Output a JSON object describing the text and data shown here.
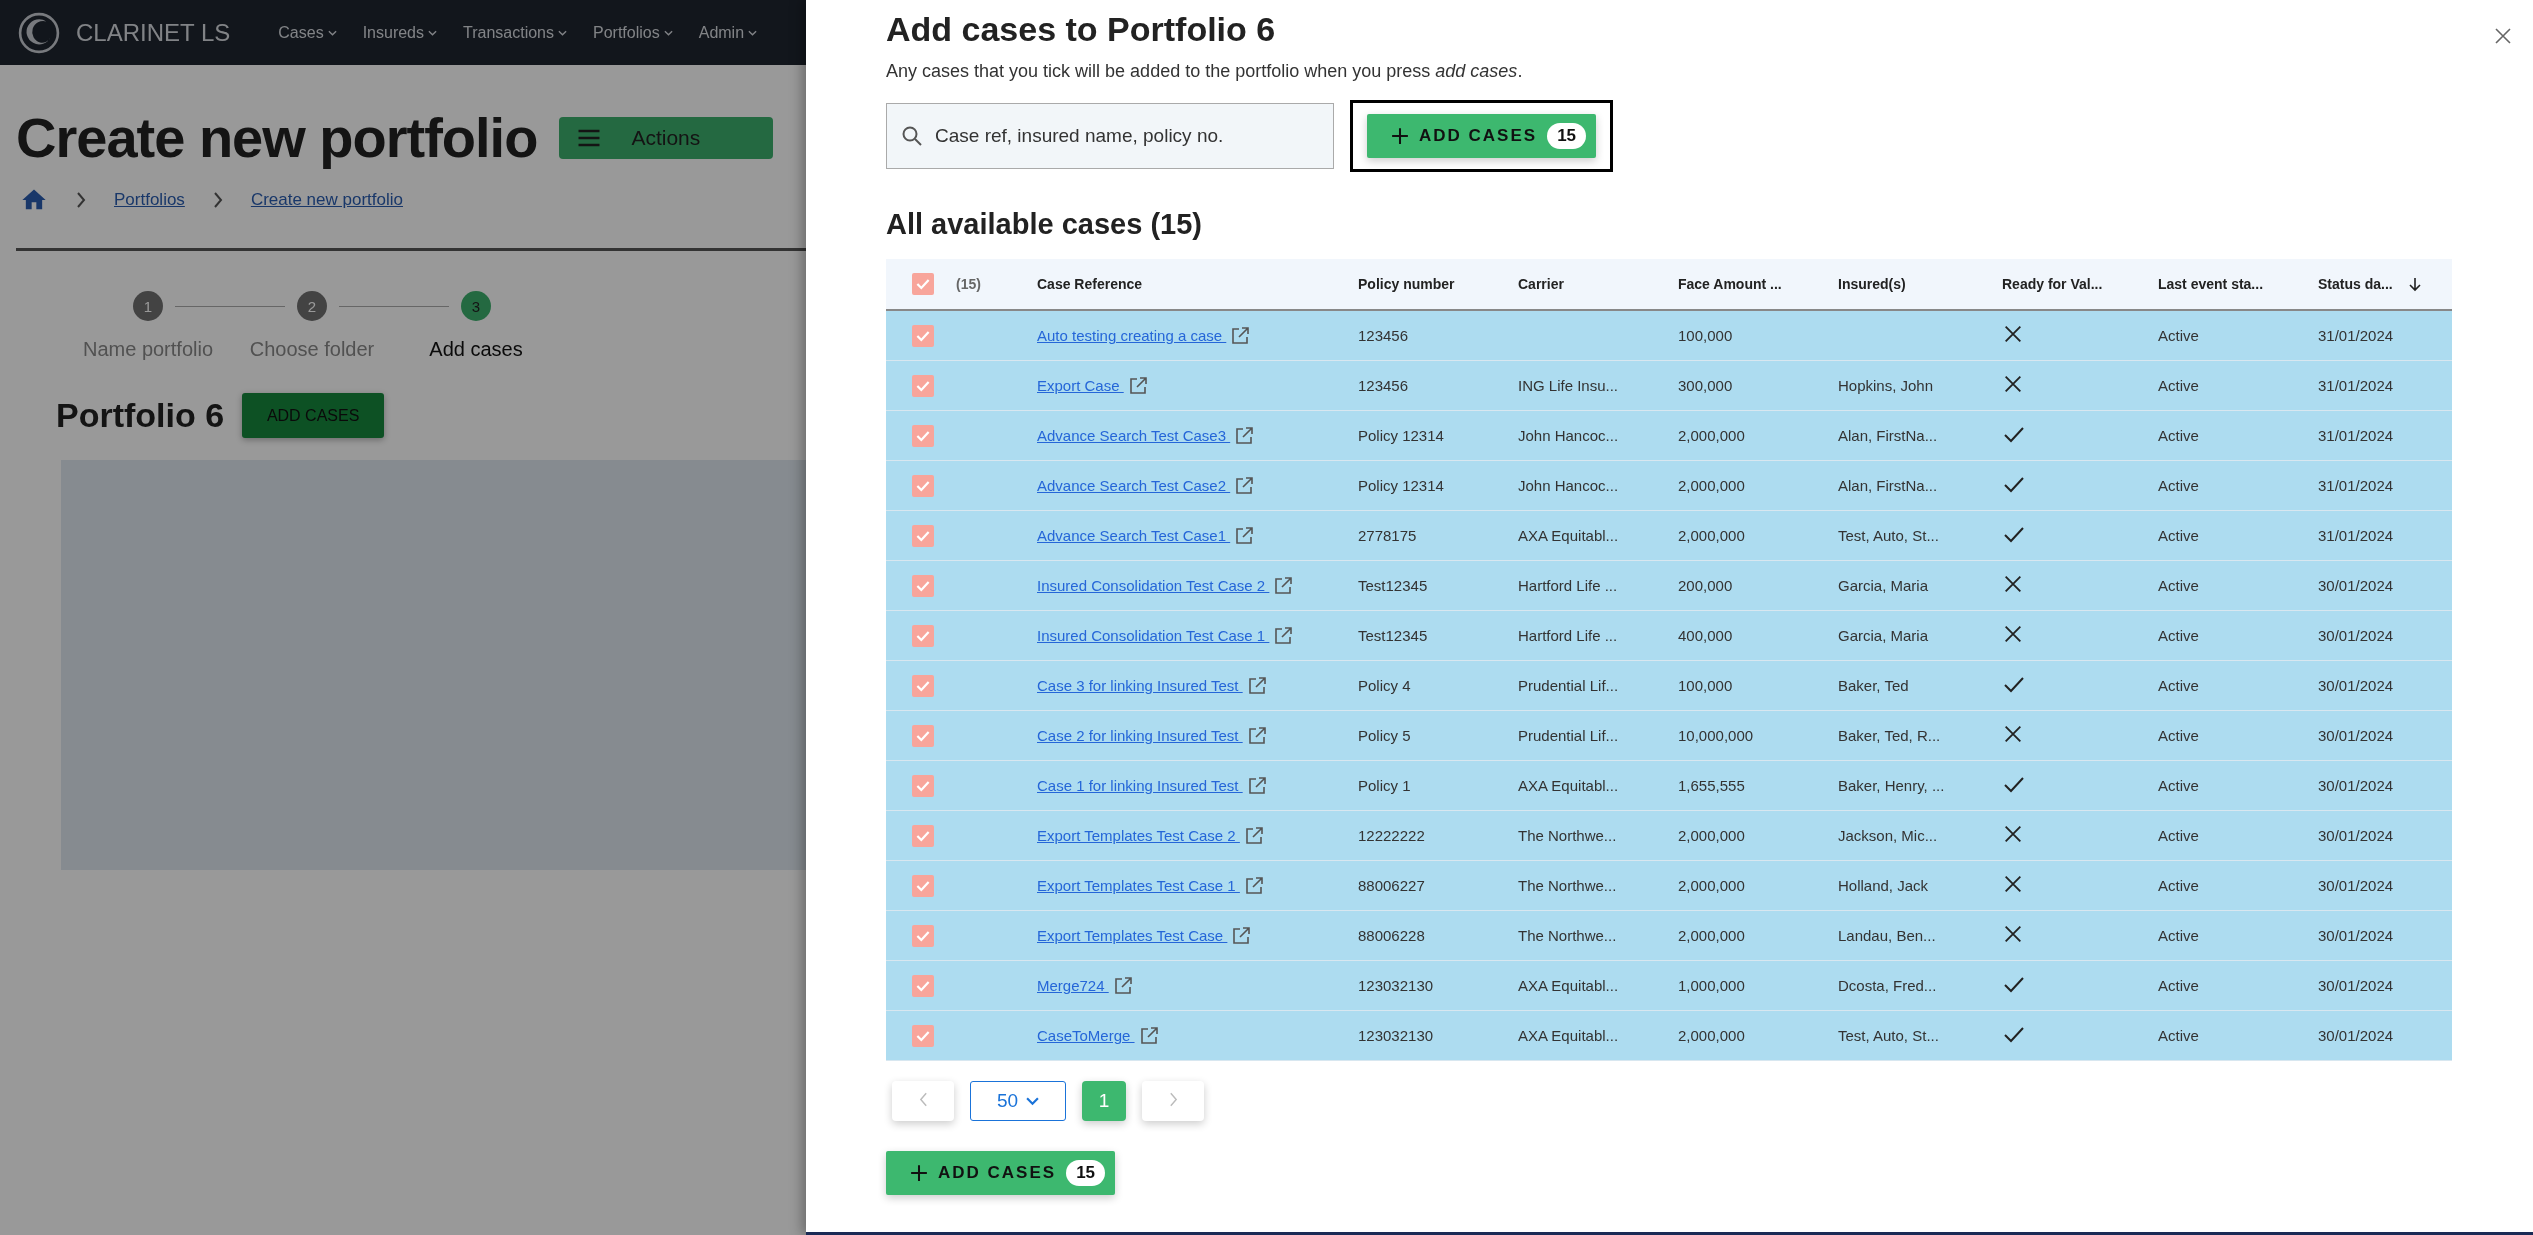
{
  "nav": {
    "brand": "CLARINET LS",
    "menus": [
      "Cases",
      "Insureds",
      "Transactions",
      "Portfolios",
      "Admin"
    ]
  },
  "page": {
    "title": "Create new portfolio",
    "actions_button": "Actions",
    "breadcrumbs": [
      "Portfolios",
      "Create new portfolio"
    ],
    "steps": [
      {
        "number": "1",
        "label": "Name portfolio",
        "selected": false
      },
      {
        "number": "2",
        "label": "Choose folder",
        "selected": false
      },
      {
        "number": "3",
        "label": "Add cases",
        "selected": true
      }
    ],
    "portfolio_name": "Portfolio 6",
    "add_cases_button": "ADD CASES"
  },
  "drawer": {
    "title": "Add cases to Portfolio 6",
    "subtitle": "Any cases that you tick will be added to the portfolio when you press *add cases*.",
    "search": {
      "placeholder": "Case ref, insured name, policy no."
    },
    "add_button": {
      "label": "ADD CASES",
      "count": "15",
      "focused": true
    },
    "section_title": "All available cases (15)",
    "table": {
      "select_all_checked": true,
      "selected_count": "(15)",
      "columns": [
        {
          "label": "Case Reference",
          "sorted": false
        },
        {
          "label": "Policy number",
          "sorted": false
        },
        {
          "label": "Carrier",
          "sorted": false
        },
        {
          "label": "Face Amount ...",
          "sorted": false
        },
        {
          "label": "Insured(s)",
          "sorted": false
        },
        {
          "label": "Ready for Val...",
          "sorted": false
        },
        {
          "label": "Last event sta...",
          "sorted": false
        },
        {
          "label": "Status da...",
          "sorted": true
        }
      ],
      "rows": [
        {
          "checked": true,
          "case_reference": "Auto testing creating a case ",
          "policy_number": "123456",
          "carrier": "",
          "face_amount": "100,000",
          "insured": "",
          "ready": false,
          "last_event_status": "Active",
          "status_date": "31/01/2024"
        },
        {
          "checked": true,
          "case_reference": "Export Case ",
          "policy_number": "123456",
          "carrier": "ING Life Insu...",
          "face_amount": "300,000",
          "insured": "Hopkins, John",
          "ready": false,
          "last_event_status": "Active",
          "status_date": "31/01/2024"
        },
        {
          "checked": true,
          "case_reference": "Advance Search Test Case3 ",
          "policy_number": "Policy 12314",
          "carrier": "John Hancoc...",
          "face_amount": "2,000,000",
          "insured": "Alan, FirstNa...",
          "ready": true,
          "last_event_status": "Active",
          "status_date": "31/01/2024"
        },
        {
          "checked": true,
          "case_reference": "Advance Search Test Case2 ",
          "policy_number": "Policy 12314",
          "carrier": "John Hancoc...",
          "face_amount": "2,000,000",
          "insured": "Alan, FirstNa...",
          "ready": true,
          "last_event_status": "Active",
          "status_date": "31/01/2024"
        },
        {
          "checked": true,
          "case_reference": "Advance Search Test Case1 ",
          "policy_number": "2778175",
          "carrier": "AXA Equitabl...",
          "face_amount": "2,000,000",
          "insured": "Test, Auto, St...",
          "ready": true,
          "last_event_status": "Active",
          "status_date": "31/01/2024"
        },
        {
          "checked": true,
          "case_reference": "Insured Consolidation Test Case 2 ",
          "policy_number": "Test12345",
          "carrier": "Hartford Life ...",
          "face_amount": "200,000",
          "insured": "Garcia, Maria",
          "ready": false,
          "last_event_status": "Active",
          "status_date": "30/01/2024"
        },
        {
          "checked": true,
          "case_reference": "Insured Consolidation Test Case 1 ",
          "policy_number": "Test12345",
          "carrier": "Hartford Life ...",
          "face_amount": "400,000",
          "insured": "Garcia, Maria",
          "ready": false,
          "last_event_status": "Active",
          "status_date": "30/01/2024"
        },
        {
          "checked": true,
          "case_reference": "Case 3 for linking Insured Test ",
          "policy_number": "Policy 4",
          "carrier": "Prudential Lif...",
          "face_amount": "100,000",
          "insured": "Baker, Ted",
          "ready": true,
          "last_event_status": "Active",
          "status_date": "30/01/2024"
        },
        {
          "checked": true,
          "case_reference": "Case 2 for linking Insured Test ",
          "policy_number": "Policy 5",
          "carrier": "Prudential Lif...",
          "face_amount": "10,000,000",
          "insured": "Baker, Ted, R...",
          "ready": false,
          "last_event_status": "Active",
          "status_date": "30/01/2024"
        },
        {
          "checked": true,
          "case_reference": "Case 1 for linking Insured Test ",
          "policy_number": "Policy 1",
          "carrier": "AXA Equitabl...",
          "face_amount": "1,655,555",
          "insured": "Baker, Henry, ...",
          "ready": true,
          "last_event_status": "Active",
          "status_date": "30/01/2024"
        },
        {
          "checked": true,
          "case_reference": "Export Templates Test Case 2 ",
          "policy_number": "12222222",
          "carrier": "The Northwe...",
          "face_amount": "2,000,000",
          "insured": "Jackson, Mic...",
          "ready": false,
          "last_event_status": "Active",
          "status_date": "30/01/2024"
        },
        {
          "checked": true,
          "case_reference": "Export Templates Test Case 1 ",
          "policy_number": "88006227",
          "carrier": "The Northwe...",
          "face_amount": "2,000,000",
          "insured": "Holland, Jack",
          "ready": false,
          "last_event_status": "Active",
          "status_date": "30/01/2024"
        },
        {
          "checked": true,
          "case_reference": "Export Templates Test Case ",
          "policy_number": "88006228",
          "carrier": "The Northwe...",
          "face_amount": "2,000,000",
          "insured": "Landau, Ben...",
          "ready": false,
          "last_event_status": "Active",
          "status_date": "30/01/2024"
        },
        {
          "checked": true,
          "case_reference": "Merge724 ",
          "policy_number": "123032130",
          "carrier": "AXA Equitabl...",
          "face_amount": "1,000,000",
          "insured": "Dcosta, Fred...",
          "ready": true,
          "last_event_status": "Active",
          "status_date": "30/01/2024"
        },
        {
          "checked": true,
          "case_reference": "CaseToMerge ",
          "policy_number": "123032130",
          "carrier": "AXA Equitabl...",
          "face_amount": "2,000,000",
          "insured": "Test, Auto, St...",
          "ready": true,
          "last_event_status": "Active",
          "status_date": "30/01/2024"
        }
      ]
    },
    "pagination": {
      "page_size": "50",
      "pages": [
        {
          "label": "1",
          "selected": true
        }
      ]
    },
    "bottom_button": {
      "label": "ADD CASES",
      "count": "15"
    }
  }
}
